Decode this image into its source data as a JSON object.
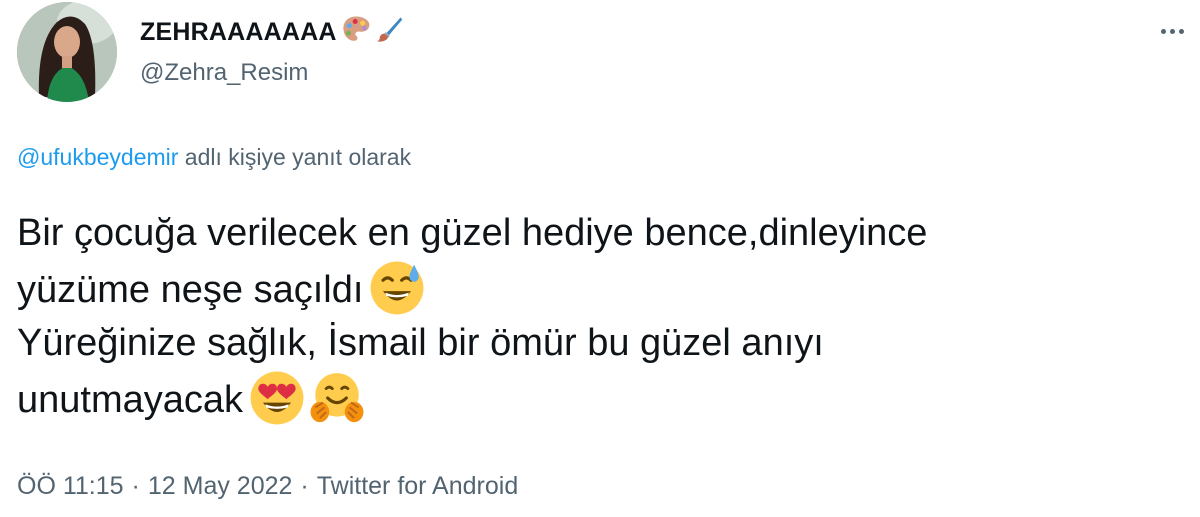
{
  "user": {
    "display_name": "ZEHRAAAAAAA",
    "name_emojis": [
      "artist-palette-emoji",
      "paintbrush-emoji"
    ],
    "handle": "@Zehra_Resim"
  },
  "reply": {
    "mention": "@ufukbeydemir",
    "suffix": " adlı kişiye yanıt olarak"
  },
  "tweet": {
    "lines": [
      "Bir çocuğa verilecek en güzel hediye bence,dinleyince",
      "yüzüme neşe saçıldı",
      "Yüreğinize sağlık, İsmail bir ömür bu güzel anıyı",
      "unutmayacak"
    ],
    "emojis": [
      "grinning-sweat-emoji",
      "heart-eyes-emoji",
      "hugging-face-emoji"
    ]
  },
  "meta": {
    "time": "ÖÖ 11:15",
    "separator": "·",
    "date": "12 May 2022",
    "client": "Twitter for Android"
  },
  "colors": {
    "text": "#0f1419",
    "secondary": "#536471",
    "link": "#1d9bf0"
  }
}
